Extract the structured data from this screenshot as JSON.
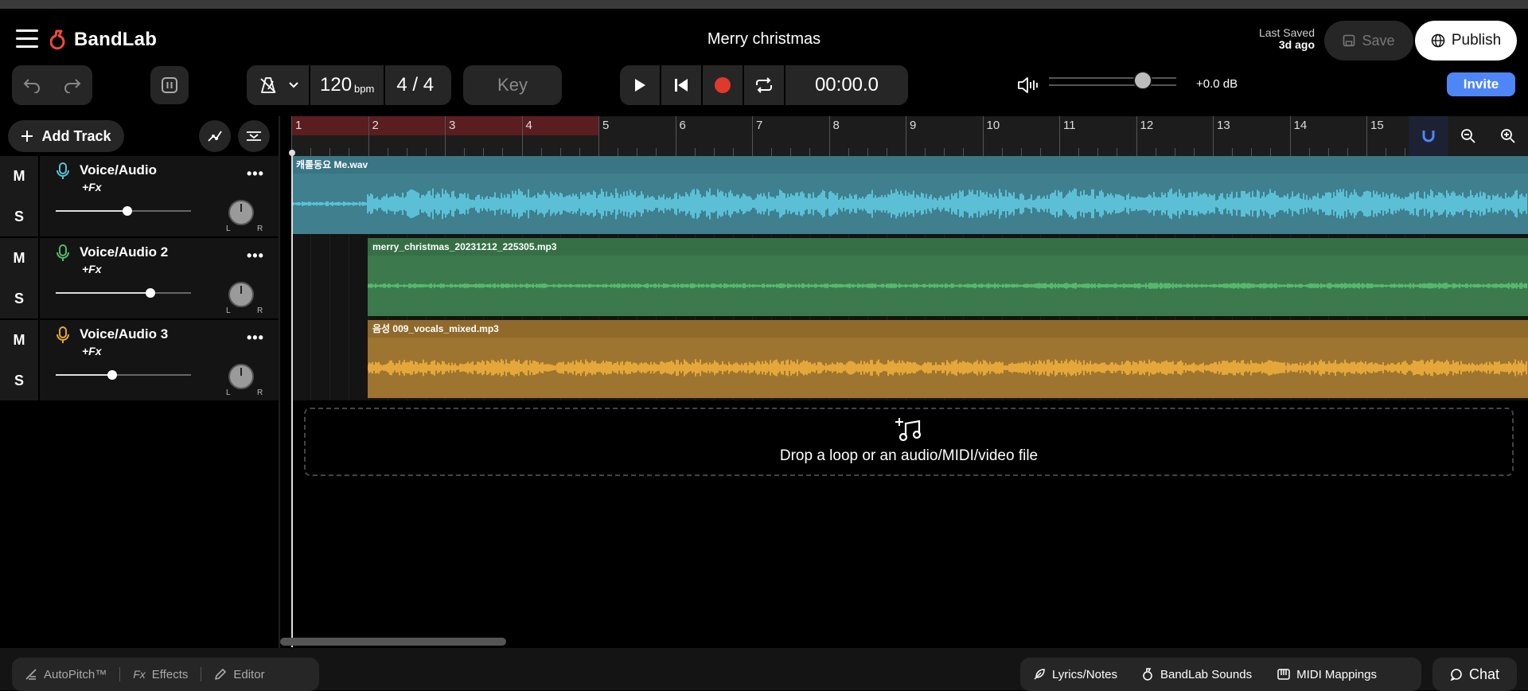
{
  "header": {
    "app_name": "BandLab",
    "project_title": "Merry christmas",
    "last_saved_label": "Last Saved",
    "last_saved_value": "3d ago",
    "save_label": "Save",
    "publish_label": "Publish"
  },
  "transport": {
    "tempo": "120",
    "bpm_unit": "bpm",
    "time_signature": "4 / 4",
    "key_label": "Key",
    "time": "00:00.0",
    "volume_db": "+0.0 dB",
    "volume_level": 0.78,
    "invite_label": "Invite"
  },
  "tracks_panel": {
    "add_track_label": "Add Track",
    "mute_label": "M",
    "solo_label": "S",
    "fx_label": "+Fx",
    "pan_left": "L",
    "pan_right": "R",
    "tracks": [
      {
        "name": "Voice/Audio",
        "icon": "microphone-icon",
        "color": "#5bc0d6",
        "volume": 0.53
      },
      {
        "name": "Voice/Audio 2",
        "icon": "microphone-icon",
        "color": "#55b96a",
        "volume": 0.7
      },
      {
        "name": "Voice/Audio 3",
        "icon": "microphone-icon",
        "color": "#e5a73a",
        "volume": 0.42
      }
    ]
  },
  "timeline": {
    "bars": [
      "1",
      "2",
      "3",
      "4",
      "5",
      "6",
      "7",
      "8",
      "9",
      "10",
      "11",
      "12",
      "13",
      "14",
      "15"
    ],
    "loop_region_bars": [
      1,
      5
    ],
    "clips": [
      {
        "name": "캐롤동요 Me.wav",
        "color": "#5bc0d6"
      },
      {
        "name": "merry_christmas_20231212_225305.mp3",
        "color": "#55b96a"
      },
      {
        "name": "음성 009_vocals_mixed.mp3",
        "color": "#e5a73a"
      }
    ],
    "drop_text": "Drop a loop or an audio/MIDI/video file"
  },
  "footer": {
    "autopitch_label": "AutoPitch™",
    "effects_label": "Effects",
    "editor_label": "Editor",
    "lyrics_label": "Lyrics/Notes",
    "sounds_label": "BandLab Sounds",
    "midi_label": "MIDI Mappings",
    "chat_label": "Chat"
  },
  "colors": {
    "accent": "#4f86f7",
    "record": "#e0392c",
    "brand": "#f04b3c"
  }
}
